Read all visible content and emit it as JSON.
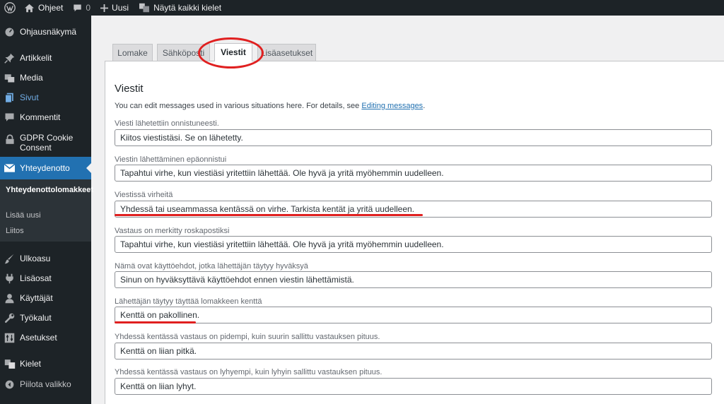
{
  "adminbar": {
    "site_name": "Ohjeet",
    "comments_count": "0",
    "new_label": "Uusi",
    "languages_label": "Näytä kaikki kielet"
  },
  "sidebar": {
    "items": [
      {
        "label": "Ohjausnäkymä",
        "icon": "dashboard-icon"
      },
      {
        "label": "Artikkelit",
        "icon": "pin-icon"
      },
      {
        "label": "Media",
        "icon": "media-icon"
      },
      {
        "label": "Sivut",
        "icon": "pages-icon"
      },
      {
        "label": "Kommentit",
        "icon": "comment-icon"
      },
      {
        "label": "GDPR Cookie Consent",
        "icon": "lock-icon"
      },
      {
        "label": "Yhteydenotto",
        "icon": "envelope-icon"
      },
      {
        "label": "Ulkoasu",
        "icon": "brush-icon"
      },
      {
        "label": "Lisäosat",
        "icon": "plugin-icon"
      },
      {
        "label": "Käyttäjät",
        "icon": "user-icon"
      },
      {
        "label": "Työkalut",
        "icon": "wrench-icon"
      },
      {
        "label": "Asetukset",
        "icon": "settings-icon"
      },
      {
        "label": "Kielet",
        "icon": "translate-icon"
      },
      {
        "label": "Piilota valikko",
        "icon": "collapse-icon"
      }
    ],
    "submenu": [
      {
        "label": "Yhteydenottolomakkeet"
      },
      {
        "label": "Lisää uusi"
      },
      {
        "label": "Liitos"
      }
    ]
  },
  "tabs": [
    {
      "label": "Lomake"
    },
    {
      "label": "Sähköposti"
    },
    {
      "label": "Viestit"
    },
    {
      "label": "Lisäasetukset"
    }
  ],
  "panel": {
    "title": "Viestit",
    "description": "You can edit messages used in various situations here. For details, see ",
    "description_link": "Editing messages",
    "description_end": ".",
    "fields": [
      {
        "label": "Viesti lähetettiin onnistuneesti.",
        "value": "Kiitos viestistäsi. Se on lähetetty."
      },
      {
        "label": "Viestin lähettäminen epäonnistui",
        "value": "Tapahtui virhe, kun viestiäsi yritettiin lähettää. Ole hyvä ja yritä myöhemmin uudelleen."
      },
      {
        "label": "Viestissä virheitä",
        "value": "Yhdessä tai useammassa kentässä on virhe. Tarkista kentät ja yritä uudelleen."
      },
      {
        "label": "Vastaus on merkitty roskapostiksi",
        "value": "Tapahtui virhe, kun viestiäsi yritettiin lähettää. Ole hyvä ja yritä myöhemmin uudelleen."
      },
      {
        "label": "Nämä ovat käyttöehdot, jotka lähettäjän täytyy hyväksyä",
        "value": "Sinun on hyväksyttävä käyttöehdot ennen viestin lähettämistä."
      },
      {
        "label": "Lähettäjän täytyy täyttää lomakkeen kenttä",
        "value": "Kenttä on pakollinen."
      },
      {
        "label": "Yhdessä kentässä vastaus on pidempi, kuin suurin sallittu vastauksen pituus.",
        "value": "Kenttä on liian pitkä."
      },
      {
        "label": "Yhdessä kentässä vastaus on lyhyempi, kuin lyhyin sallittu vastauksen pituus.",
        "value": "Kenttä on liian lyhyt."
      }
    ]
  },
  "colors": {
    "sidebar_bg": "#1d2327",
    "active_menu": "#2271b1",
    "link": "#2271b1",
    "annotation_red": "#e02020"
  }
}
